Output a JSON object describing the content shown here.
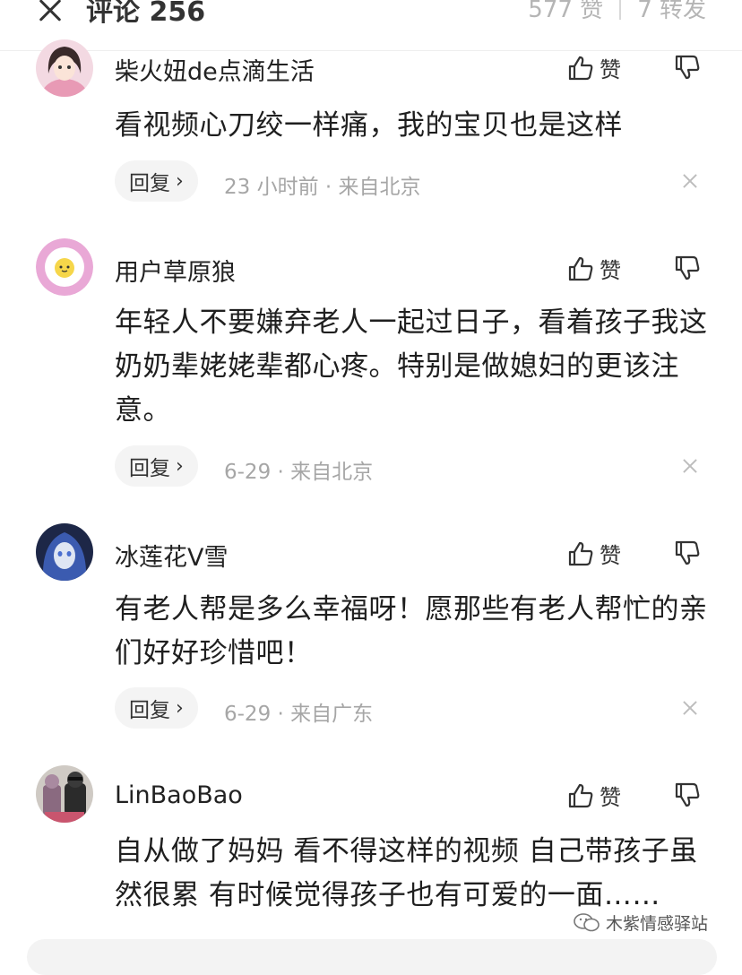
{
  "header": {
    "title": "评论 256",
    "likes": "577 赞",
    "reposts": "7 转发"
  },
  "like_label": "赞",
  "reply_label": "回复",
  "reply_chevron": "›",
  "comments": [
    {
      "name": "柴火妞de点滴生活",
      "text": "看视频心刀绞一样痛，我的宝贝也是这样",
      "meta": "23 小时前 · 来自北京"
    },
    {
      "name": "用户草原狼",
      "text": "年轻人不要嫌弃老人一起过日子，看着孩子我这奶奶辈姥姥辈都心疼。特别是做媳妇的更该注意。",
      "meta": "6-29 · 来自北京"
    },
    {
      "name": "冰莲花V雪",
      "text": "有老人帮是多么幸福呀！愿那些有老人帮忙的亲们好好珍惜吧！",
      "meta": "6-29 · 来自广东"
    },
    {
      "name": "LinBaoBao",
      "text": "自从做了妈妈 看不得这样的视频 自己带孩子虽然很累 有时候觉得孩子也有可爱的一面……"
    }
  ],
  "watermark": "木紫情感驿站",
  "colors": {
    "text": "#222222",
    "meta": "#a6a6a6",
    "header_stats": "#b5b5b5",
    "reply_bg": "#f4f4f4"
  },
  "icons": [
    "close-icon",
    "thumbs-up-icon",
    "thumbs-down-icon",
    "chevron-right-icon",
    "dismiss-icon",
    "wechat-icon"
  ]
}
